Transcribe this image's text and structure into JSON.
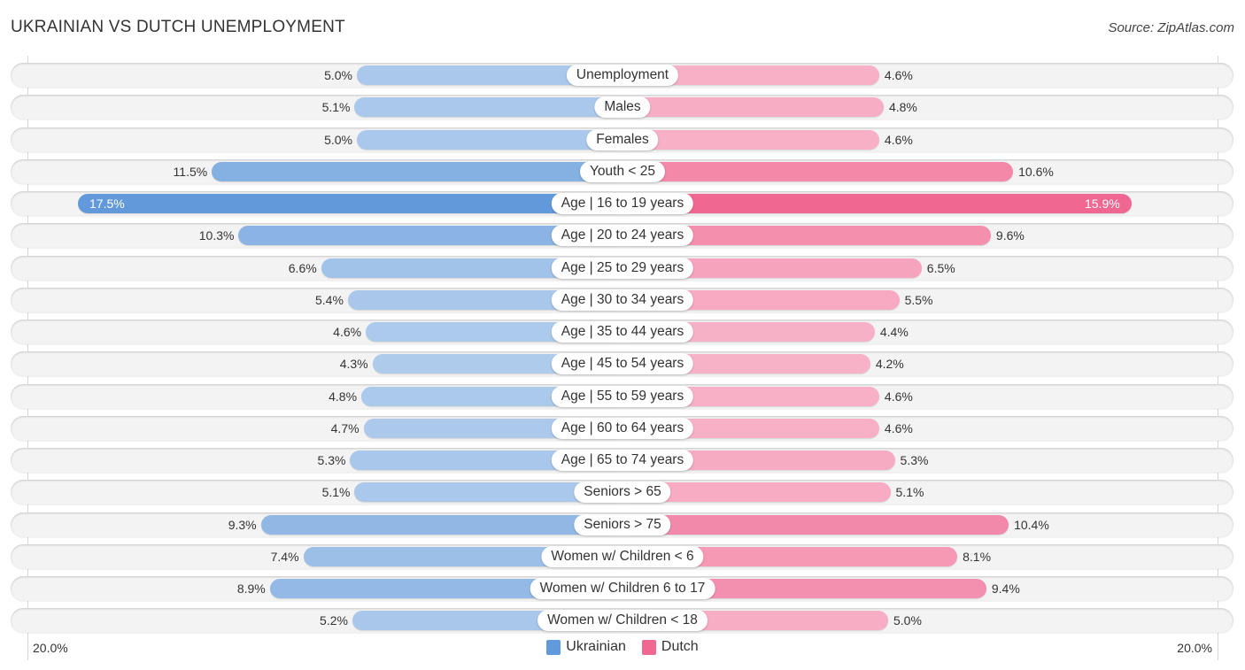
{
  "header": {
    "title": "UKRAINIAN VS DUTCH UNEMPLOYMENT",
    "source": "Source: ZipAtlas.com"
  },
  "colors": {
    "ukrainian": "#6199da",
    "dutch": "#f06892"
  },
  "chart_data": {
    "type": "bar",
    "orientation": "horizontal-diverging",
    "title": "UKRAINIAN VS DUTCH UNEMPLOYMENT",
    "xlabel": "",
    "ylabel": "",
    "xlim": [
      -20.0,
      20.0
    ],
    "axis_ticks": {
      "left": "20.0%",
      "right": "20.0%"
    },
    "legend_position": "bottom-center",
    "categories": [
      "Unemployment",
      "Males",
      "Females",
      "Youth < 25",
      "Age | 16 to 19 years",
      "Age | 20 to 24 years",
      "Age | 25 to 29 years",
      "Age | 30 to 34 years",
      "Age | 35 to 44 years",
      "Age | 45 to 54 years",
      "Age | 55 to 59 years",
      "Age | 60 to 64 years",
      "Age | 65 to 74 years",
      "Seniors > 65",
      "Seniors > 75",
      "Women w/ Children < 6",
      "Women w/ Children 6 to 17",
      "Women w/ Children < 18"
    ],
    "series": [
      {
        "name": "Ukrainian",
        "side": "left",
        "values": [
          5.0,
          5.1,
          5.0,
          11.5,
          17.5,
          10.3,
          6.6,
          5.4,
          4.6,
          4.3,
          4.8,
          4.7,
          5.3,
          5.1,
          9.3,
          7.4,
          8.9,
          5.2
        ],
        "labels": [
          "5.0%",
          "5.1%",
          "5.0%",
          "11.5%",
          "17.5%",
          "10.3%",
          "6.6%",
          "5.4%",
          "4.6%",
          "4.3%",
          "4.8%",
          "4.7%",
          "5.3%",
          "5.1%",
          "9.3%",
          "7.4%",
          "8.9%",
          "5.2%"
        ]
      },
      {
        "name": "Dutch",
        "side": "right",
        "values": [
          4.6,
          4.8,
          4.6,
          10.6,
          15.9,
          9.6,
          6.5,
          5.5,
          4.4,
          4.2,
          4.6,
          4.6,
          5.3,
          5.1,
          10.4,
          8.1,
          9.4,
          5.0
        ],
        "labels": [
          "4.6%",
          "4.8%",
          "4.6%",
          "10.6%",
          "15.9%",
          "9.6%",
          "6.5%",
          "5.5%",
          "4.4%",
          "4.2%",
          "4.6%",
          "4.6%",
          "5.3%",
          "5.1%",
          "10.4%",
          "8.1%",
          "9.4%",
          "5.0%"
        ]
      }
    ]
  },
  "legend": [
    {
      "name": "Ukrainian",
      "color": "#6199da"
    },
    {
      "name": "Dutch",
      "color": "#f06892"
    }
  ]
}
